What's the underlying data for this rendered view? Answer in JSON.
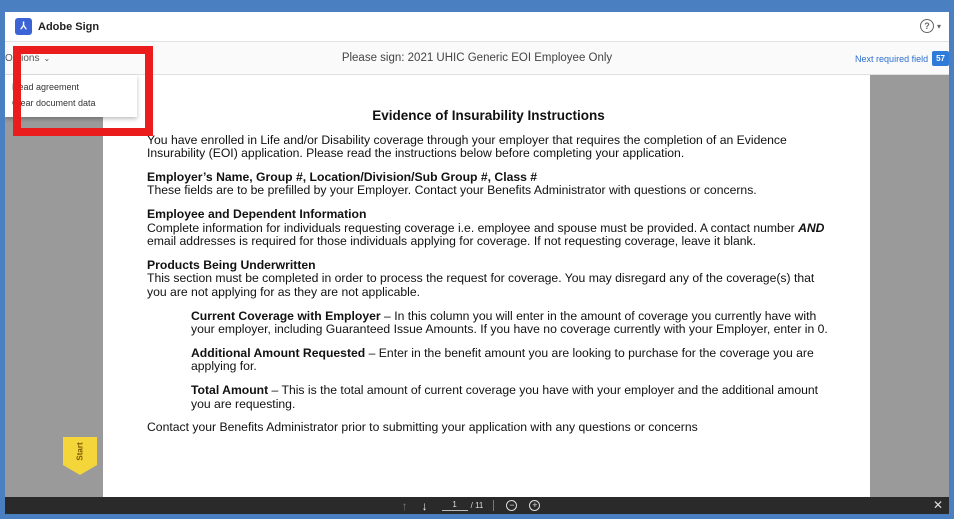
{
  "header": {
    "app_title": "Adobe Sign",
    "help_icon": "?",
    "help_caret": "▾"
  },
  "toolbar": {
    "options_label": "Options",
    "options_chevron": "⌄",
    "document_title": "Please sign: 2021 UHIC Generic EOI Employee Only",
    "next_required_label": "Next required field",
    "next_required_count": "57"
  },
  "options_menu": {
    "items": [
      "Read agreement",
      "Clear document data"
    ]
  },
  "document": {
    "heading": "Evidence of Insurability Instructions",
    "intro": "You have enrolled in Life and/or Disability coverage through your employer that requires the completion of an Evidence Insurability (EOI) application. Please read the instructions below before completing your application.",
    "s1_title": "Employer’s Name, Group #, Location/Division/Sub Group #, Class #",
    "s1_body": "These fields are to be prefilled by your Employer. Contact your Benefits Administrator with questions or concerns.",
    "s2_title": "Employee and Dependent Information",
    "s2_body_a": "Complete information for individuals requesting coverage i.e. employee and spouse must be provided. A contact number ",
    "s2_body_em": "AND",
    "s2_body_b": " email addresses is required for those individuals applying for coverage. If not requesting coverage, leave it blank.",
    "s3_title": "Products Being Underwritten",
    "s3_body": "This section must be completed in order to process the request for coverage. You may disregard any of the coverage(s) that you are not applying for as they are not applicable.",
    "i1_title": "Current Coverage with Employer",
    "i1_body": " – In this column you will enter in the amount of coverage you currently have with your employer, including Guaranteed Issue Amounts. If you have no coverage currently with your Employer, enter in 0.",
    "i2_title": "Additional Amount Requested",
    "i2_body": " – Enter in the benefit amount you are looking to purchase for the coverage you are applying for.",
    "i3_title": "Total Amount",
    "i3_body": " – This is the total amount of current coverage you have with your employer and the additional amount you are requesting.",
    "footer": "Contact your Benefits Administrator prior to submitting your application with any questions or concerns"
  },
  "start_tag": "Start",
  "pager": {
    "prev_icon": "↑",
    "next_icon": "↓",
    "current_page": "1",
    "total_pages": "/ 11",
    "zoom_out": "−",
    "zoom_in": "+",
    "close_icon": "✕"
  },
  "colors": {
    "accent": "#2f7bd9",
    "highlight_box": "#ea1c1c",
    "start_tag": "#f5d63a"
  }
}
